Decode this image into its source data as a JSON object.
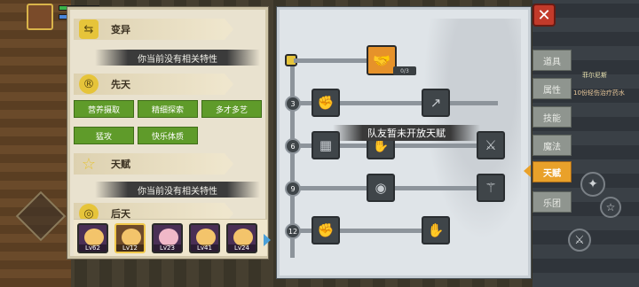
{
  "sections": [
    {
      "title": "变异",
      "icon": "mutation-icon",
      "band": "你当前没有相关特性"
    },
    {
      "title": "先天",
      "icon": "innate-icon",
      "traits": [
        "营养摄取",
        "精细探索",
        "多才多艺",
        "猛攻",
        "快乐体质"
      ]
    },
    {
      "title": "天赋",
      "icon": "star-icon",
      "band": "你当前没有相关特性"
    },
    {
      "title": "后天",
      "icon": "acquired-icon"
    }
  ],
  "party": [
    {
      "level": "Lv62",
      "selected": false
    },
    {
      "level": "Lv12",
      "selected": true
    },
    {
      "level": "Lv23",
      "selected": false
    },
    {
      "level": "Lv41",
      "selected": false
    },
    {
      "level": "Lv24",
      "selected": false
    }
  ],
  "talent": {
    "top_count": "0/3",
    "notice": "队友暂未开放天赋",
    "levels": [
      "3",
      "6",
      "9",
      "12"
    ]
  },
  "tabs": [
    "道具",
    "属性",
    "技能",
    "魔法",
    "天赋",
    "乐团"
  ],
  "active_tab": "天赋",
  "hud": {
    "right_label_1": "菲尔尼斯",
    "right_label_2": "10份轻伤治疗药水"
  },
  "colors": {
    "accent": "#e9a12a",
    "trait_green": "#5f9b2a",
    "close_red": "#c23a2a"
  }
}
